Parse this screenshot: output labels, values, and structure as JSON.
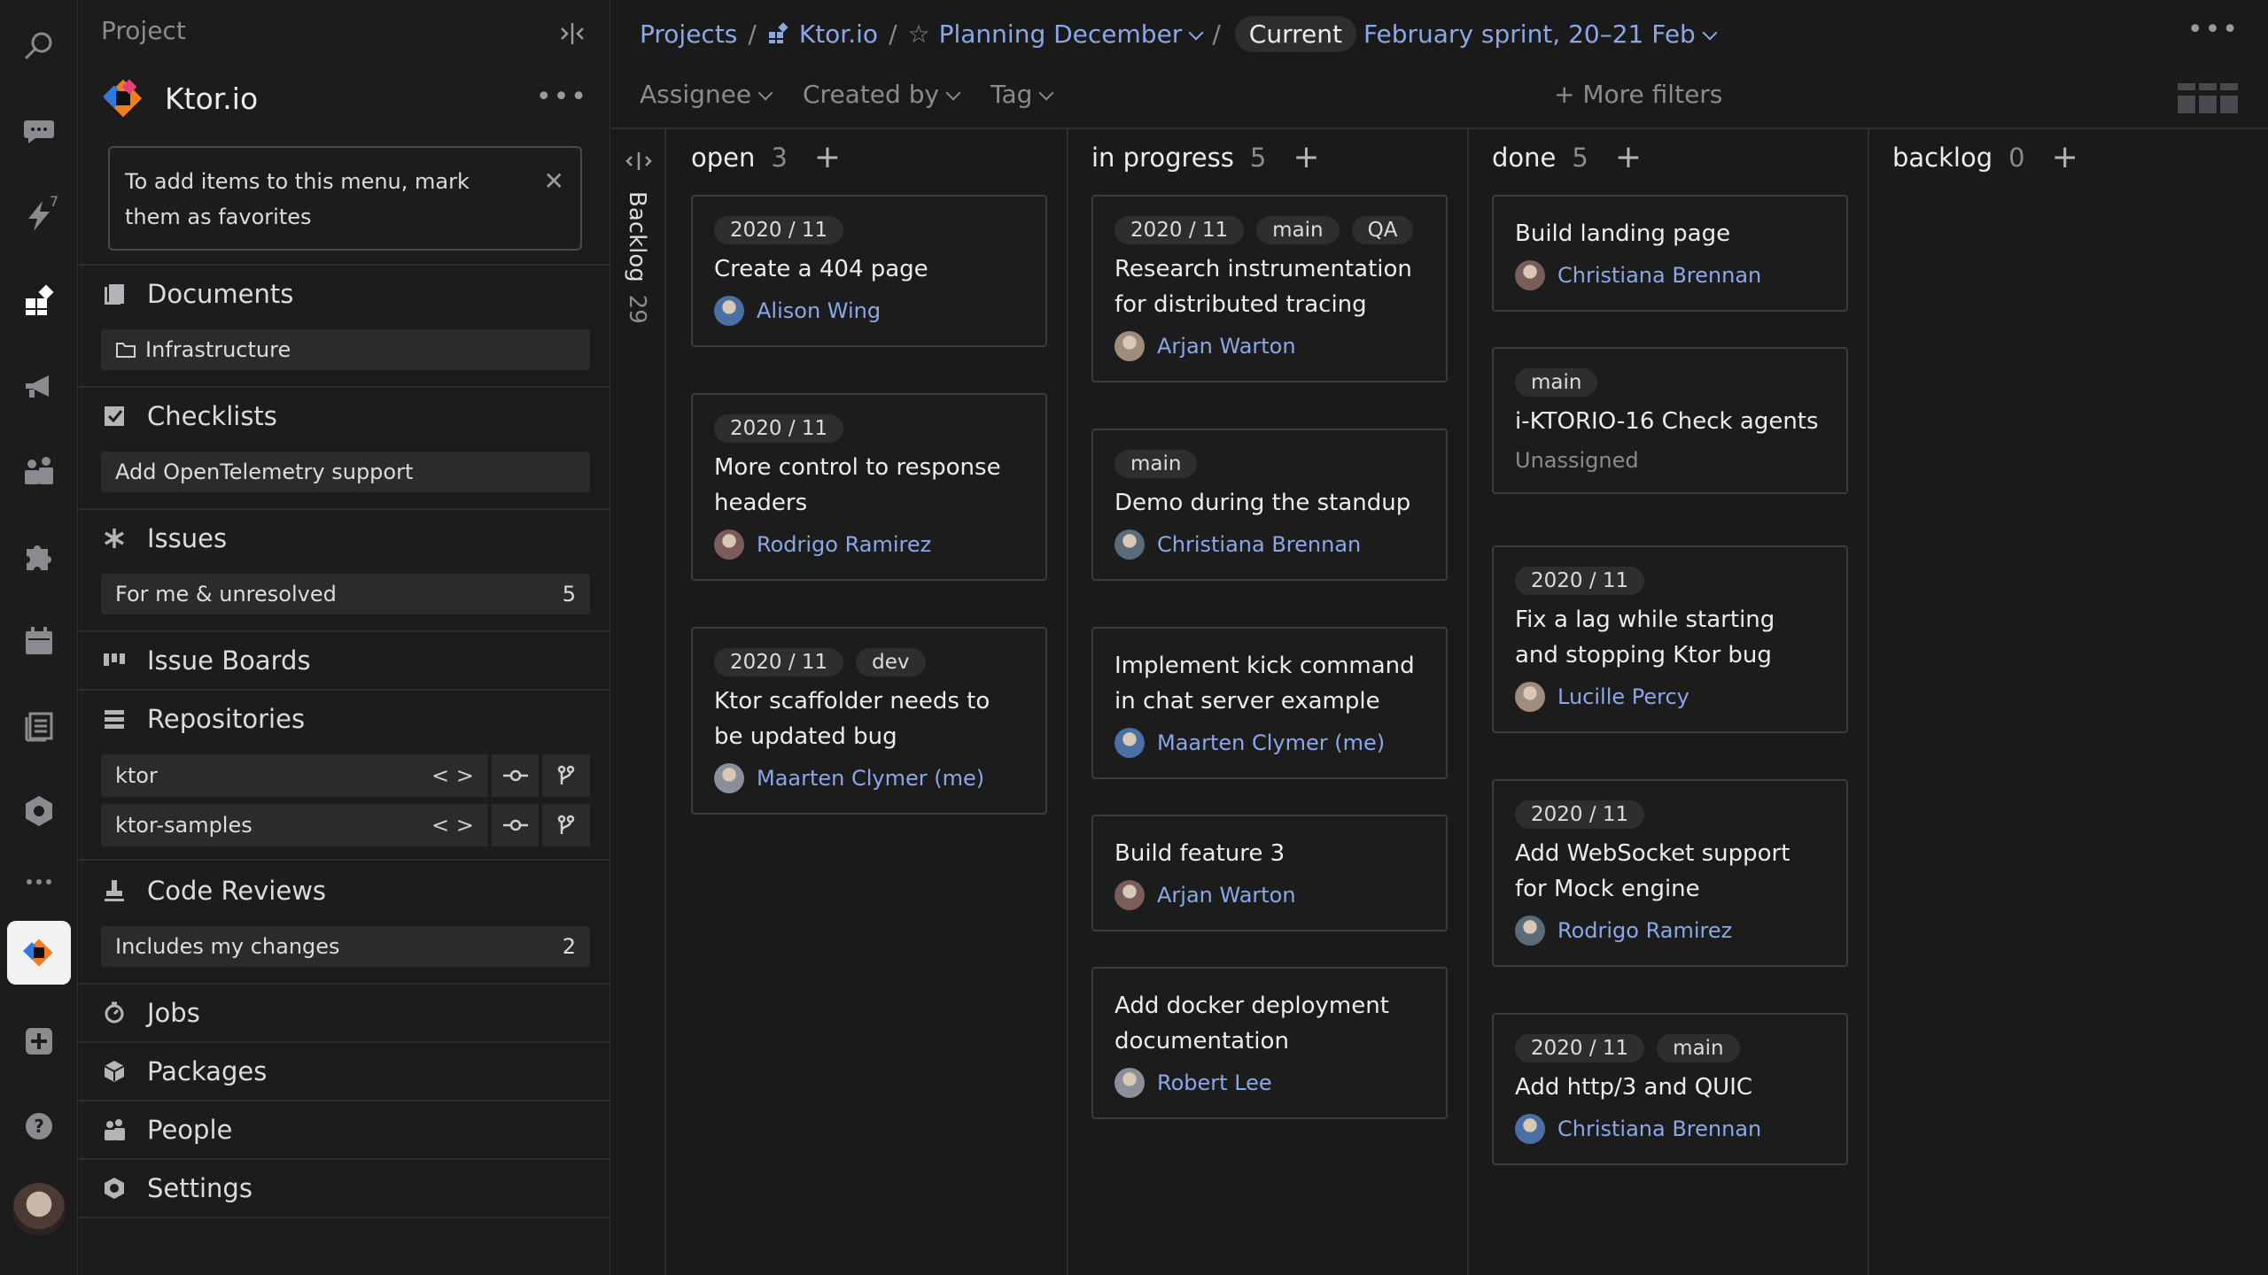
{
  "sidebar": {
    "header": "Project",
    "project_name": "Ktor.io",
    "tip": "To add items to this menu, mark them as favorites",
    "sections": {
      "documents": "Documents",
      "checklists": "Checklists",
      "issues": "Issues",
      "issue_boards": "Issue Boards",
      "repositories": "Repositories",
      "code_reviews": "Code Reviews",
      "jobs": "Jobs",
      "packages": "Packages",
      "people": "People",
      "settings": "Settings"
    },
    "documents_item": "Infrastructure",
    "checklists_item": "Add OpenTelemetry support",
    "issues_item": {
      "label": "For me & unresolved",
      "count": "5"
    },
    "repos": [
      {
        "name": "ktor",
        "code": "< >"
      },
      {
        "name": "ktor-samples",
        "code": "< >"
      }
    ],
    "code_reviews_item": {
      "label": "Includes my changes",
      "count": "2"
    }
  },
  "rail": {
    "lightning_badge": "7"
  },
  "breadcrumb": {
    "projects": "Projects",
    "project": "Ktor.io",
    "board": "Planning December",
    "current": "Current",
    "sprint": "February sprint, 20–21 Feb",
    "sep": "/"
  },
  "filters": {
    "assignee": "Assignee",
    "created_by": "Created by",
    "tag": "Tag",
    "more": "+ More filters"
  },
  "backlog": {
    "label": "Backlog",
    "count": "29"
  },
  "columns": [
    {
      "title": "open",
      "count": "3",
      "cards": [
        {
          "tags": [
            "2020 / 11"
          ],
          "title": "Create a 404 page",
          "assignee": "Alison Wing"
        },
        {
          "tags": [
            "2020 / 11"
          ],
          "title": "More control to response headers",
          "assignee": "Rodrigo Ramirez"
        },
        {
          "tags": [
            "2020 / 11",
            "dev"
          ],
          "title": "Ktor scaffolder needs to be updated bug",
          "assignee": "Maarten Clymer (me)"
        }
      ]
    },
    {
      "title": "in progress",
      "count": "5",
      "cards": [
        {
          "tags": [
            "2020 / 11",
            "main",
            "QA"
          ],
          "title": "Research instrumentation for distributed tracing",
          "assignee": "Arjan Warton"
        },
        {
          "tags": [
            "main"
          ],
          "title": "Demo during the standup",
          "assignee": "Christiana Brennan"
        },
        {
          "tags": [],
          "title": "Implement kick command in chat server example",
          "assignee": "Maarten Clymer (me)"
        },
        {
          "tags": [],
          "title": "Build feature 3",
          "assignee": "Arjan Warton"
        },
        {
          "tags": [],
          "title": "Add docker deployment documentation",
          "assignee": "Robert Lee"
        }
      ]
    },
    {
      "title": "done",
      "count": "5",
      "cards": [
        {
          "tags": [],
          "title": "Build landing page",
          "assignee": "Christiana Brennan"
        },
        {
          "tags": [
            "main"
          ],
          "title": "i-KTORIO-16 Check agents",
          "unassigned": "Unassigned"
        },
        {
          "tags": [
            "2020 / 11"
          ],
          "title": "Fix a lag while starting and stopping Ktor bug",
          "assignee": "Lucille Percy"
        },
        {
          "tags": [
            "2020 / 11"
          ],
          "title": "Add WebSocket support for Mock engine",
          "assignee": "Rodrigo Ramirez"
        },
        {
          "tags": [
            "2020 / 11",
            "main"
          ],
          "title": "Add http/3 and QUIC",
          "assignee": "Christiana Brennan"
        }
      ]
    },
    {
      "title": "backlog",
      "count": "0",
      "cards": []
    }
  ],
  "colors": {
    "background": "#1a1a1b",
    "link": "#8aa7e8",
    "muted": "#8b8b8f",
    "card_border": "#3b3b3e"
  }
}
